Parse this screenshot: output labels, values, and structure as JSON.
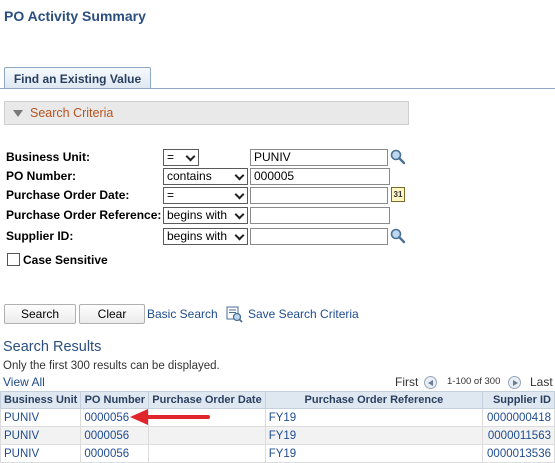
{
  "page": {
    "title": "PO Activity Summary"
  },
  "tabs": {
    "find_existing": "Find an Existing Value"
  },
  "criteria": {
    "header": "Search Criteria",
    "fields": [
      {
        "label": "Business Unit:",
        "operator": "=",
        "value": "PUNIV"
      },
      {
        "label": "PO Number:",
        "operator": "contains",
        "value": "000005"
      },
      {
        "label": "Purchase Order Date:",
        "operator": "=",
        "value": ""
      },
      {
        "label": "Purchase Order Reference:",
        "operator": "begins with",
        "value": ""
      },
      {
        "label": "Supplier ID:",
        "operator": "begins with",
        "value": ""
      }
    ],
    "case_sensitive": "Case Sensitive",
    "calendar_text": "31"
  },
  "actions": {
    "search": "Search",
    "clear": "Clear",
    "basic_search": "Basic Search",
    "save_criteria": "Save Search Criteria"
  },
  "results": {
    "title": "Search Results",
    "note": "Only the first 300 results can be displayed.",
    "view_all": "View All",
    "first": "First",
    "range": "1-100 of 300",
    "last": "Last",
    "columns": [
      "Business Unit",
      "PO Number",
      "Purchase Order Date",
      "Purchase Order Reference",
      "Supplier ID"
    ],
    "rows": [
      [
        "PUNIV",
        "0000056",
        "",
        "FY19",
        "0000000418"
      ],
      [
        "PUNIV",
        "0000056",
        "",
        "FY19",
        "0000011563"
      ],
      [
        "PUNIV",
        "0000056",
        "",
        "FY19",
        "0000013536"
      ]
    ]
  },
  "colors": {
    "link": "#1f4c8f",
    "criteria_header": "#b8541f",
    "arrow": "#e0262b",
    "title": "#2a4f7f"
  }
}
